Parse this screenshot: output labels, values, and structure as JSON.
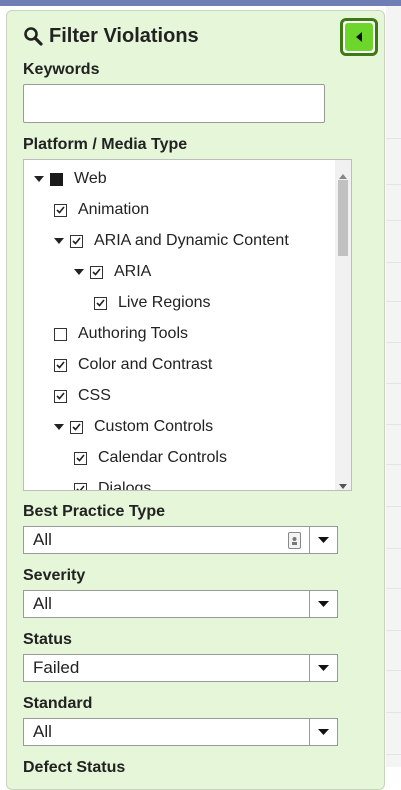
{
  "panel": {
    "title": "Filter Violations",
    "collapse_icon": "caret-left-icon",
    "search_icon": "search-icon"
  },
  "keywords": {
    "label": "Keywords",
    "value": "",
    "placeholder": ""
  },
  "platform": {
    "label": "Platform / Media Type",
    "tree": [
      {
        "label": "Web",
        "checked": "indeterminate",
        "expanded": true
      },
      {
        "label": "Animation",
        "checked": true
      },
      {
        "label": "ARIA and Dynamic Content",
        "checked": true,
        "expanded": true
      },
      {
        "label": "ARIA",
        "checked": true,
        "expanded": true
      },
      {
        "label": "Live Regions",
        "checked": true
      },
      {
        "label": "Authoring Tools",
        "checked": false
      },
      {
        "label": "Color and Contrast",
        "checked": true
      },
      {
        "label": "CSS",
        "checked": true
      },
      {
        "label": "Custom Controls",
        "checked": true,
        "expanded": true
      },
      {
        "label": "Calendar Controls",
        "checked": true
      },
      {
        "label": "Dialogs",
        "checked": true
      }
    ]
  },
  "filters": {
    "best_practice_type": {
      "label": "Best Practice Type",
      "value": "All"
    },
    "severity": {
      "label": "Severity",
      "value": "All"
    },
    "status": {
      "label": "Status",
      "value": "Failed"
    },
    "standard": {
      "label": "Standard",
      "value": "All"
    },
    "defect_status": {
      "label": "Defect Status"
    }
  },
  "colors": {
    "panel_bg": "#e6f6d9",
    "button_accent": "#6dd62a",
    "button_border": "#3d7a16",
    "top_bar": "#6f7fb5"
  }
}
